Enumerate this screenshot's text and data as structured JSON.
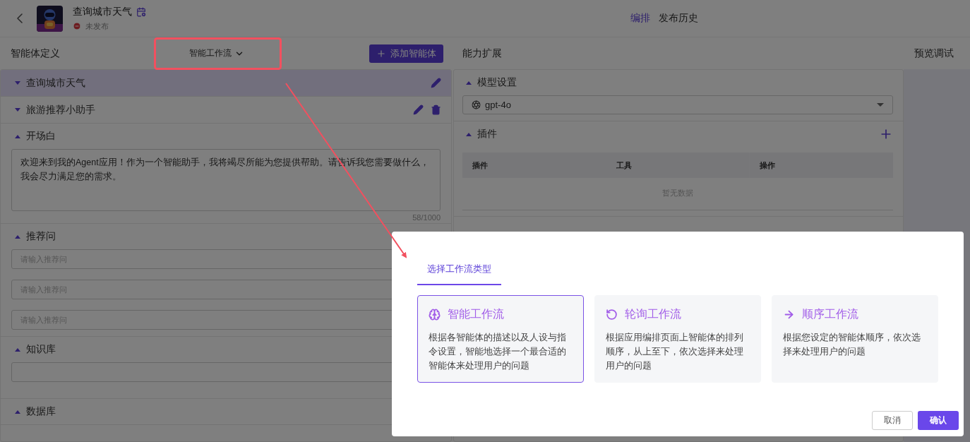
{
  "header": {
    "app_name": "查询城市天气",
    "status": "未发布",
    "tabs": [
      {
        "label": "编排",
        "selected": true
      },
      {
        "label": "发布历史",
        "selected": false
      }
    ]
  },
  "toolbar": {
    "left_title": "智能体定义",
    "workflow_dropdown": "智能工作流",
    "add_button": "添加智能体",
    "middle_title": "能力扩展",
    "right_title": "预览调试"
  },
  "agents": [
    {
      "name": "查询城市天气",
      "selected": true,
      "expanded": false,
      "deletable": false
    },
    {
      "name": "旅游推荐小助手",
      "selected": false,
      "expanded": false,
      "deletable": true
    }
  ],
  "opening": {
    "title": "开场白",
    "expanded": true,
    "value": "欢迎来到我的Agent应用！作为一个智能助手，我将竭尽所能为您提供帮助。请告诉我您需要做什么，我会尽力满足您的需求。",
    "count": "58/1000"
  },
  "suggestions": {
    "title": "推荐问",
    "expanded": true,
    "placeholders": [
      "请输入推荐问",
      "请输入推荐问",
      "请输入推荐问"
    ]
  },
  "knowledge": {
    "title": "知识库",
    "expanded": true
  },
  "database": {
    "title": "数据库",
    "expanded": true
  },
  "model": {
    "title": "模型设置",
    "expanded": true,
    "value": "gpt-4o"
  },
  "plugins": {
    "title": "插件",
    "expanded": true,
    "columns": [
      "插件",
      "工具",
      "操作"
    ],
    "empty": "暂无数据"
  },
  "dialog": {
    "tabs": [
      {
        "label": "选择工作流类型",
        "selected": true
      }
    ],
    "options": [
      {
        "kind": "smart",
        "title": "智能工作流",
        "description": "根据各智能体的描述以及人设与指令设置，智能地选择一个最合适的智能体来处理用户的问题",
        "selected": true
      },
      {
        "kind": "polling",
        "title": "轮询工作流",
        "description": "根据应用编排页面上智能体的排列顺序，从上至下，依次选择来处理用户的问题",
        "selected": false
      },
      {
        "kind": "sequence",
        "title": "顺序工作流",
        "description": "根据您设定的智能体顺序，依次选择来处理用户的问题",
        "selected": false
      }
    ],
    "cancel": "取消",
    "confirm": "确认"
  }
}
